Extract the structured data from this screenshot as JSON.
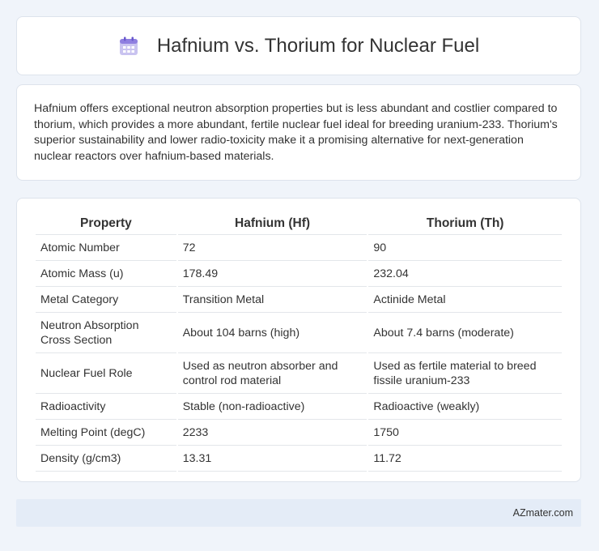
{
  "header": {
    "title": "Hafnium vs. Thorium for Nuclear Fuel",
    "icon": "calendar-icon"
  },
  "description": "Hafnium offers exceptional neutron absorption properties but is less abundant and costlier compared to thorium, which provides a more abundant, fertile nuclear fuel ideal for breeding uranium-233. Thorium's superior sustainability and lower radio-toxicity make it a promising alternative for next-generation nuclear reactors over hafnium-based materials.",
  "table": {
    "headers": [
      "Property",
      "Hafnium (Hf)",
      "Thorium (Th)"
    ],
    "rows": [
      [
        "Atomic Number",
        "72",
        "90"
      ],
      [
        "Atomic Mass (u)",
        "178.49",
        "232.04"
      ],
      [
        "Metal Category",
        "Transition Metal",
        "Actinide Metal"
      ],
      [
        "Neutron Absorption Cross Section",
        "About 104 barns (high)",
        "About 7.4 barns (moderate)"
      ],
      [
        "Nuclear Fuel Role",
        "Used as neutron absorber and control rod material",
        "Used as fertile material to breed fissile uranium-233"
      ],
      [
        "Radioactivity",
        "Stable (non-radioactive)",
        "Radioactive (weakly)"
      ],
      [
        "Melting Point (degC)",
        "2233",
        "1750"
      ],
      [
        "Density (g/cm3)",
        "13.31",
        "11.72"
      ]
    ]
  },
  "footer": {
    "brand": "AZmater.com"
  },
  "colors": {
    "background": "#f0f4fa",
    "card": "#ffffff",
    "footer": "#e4ecf7"
  }
}
